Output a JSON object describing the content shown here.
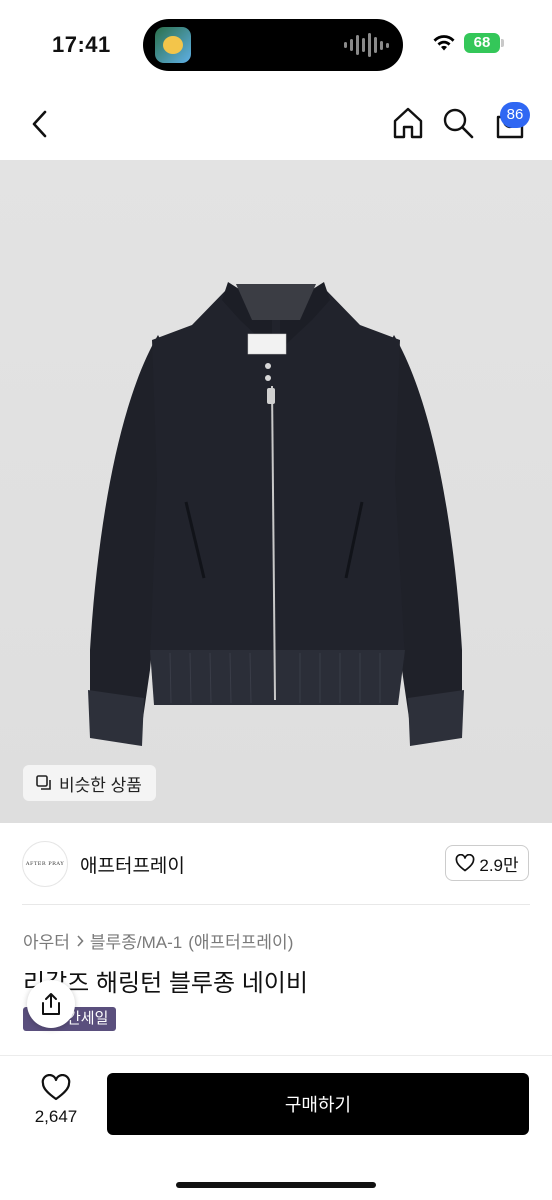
{
  "status_bar": {
    "time": "17:41",
    "battery": "68",
    "island_app_icon": "podcast-app-icon",
    "wifi_icon": "wifi-icon"
  },
  "nav": {
    "back_icon": "chevron-left-icon",
    "home_icon": "home-icon",
    "search_icon": "search-icon",
    "cart_icon": "shopping-bag-icon",
    "cart_count": "86"
  },
  "product_image": {
    "subject": "navy wool zip-up blouson jacket",
    "similar_label": "비슷한 상품",
    "similar_icon": "copy-icon"
  },
  "seller": {
    "avatar_text": "AFTER PRAY",
    "name": "애프터프레이",
    "likes": "2.9만",
    "like_icon": "heart-outline-icon"
  },
  "product": {
    "breadcrumb": [
      "아우터",
      "블루종/MA-1",
      "(애프터프레이)"
    ],
    "title": "리갈즈 해링턴 블루종 네이비",
    "badge": "한정세일",
    "badge_visible": "간세일",
    "share_icon": "share-icon"
  },
  "bottom_bar": {
    "wish_icon": "heart-outline-icon",
    "wish_count": "2,647",
    "buy_label": "구매하기"
  },
  "colors": {
    "badge_bg": "#5a4f7d",
    "cart_badge": "#2f67f3",
    "buy_button": "#000000",
    "battery": "#34c759",
    "image_bg": "#e0e0e0",
    "jacket": "#20222b"
  }
}
